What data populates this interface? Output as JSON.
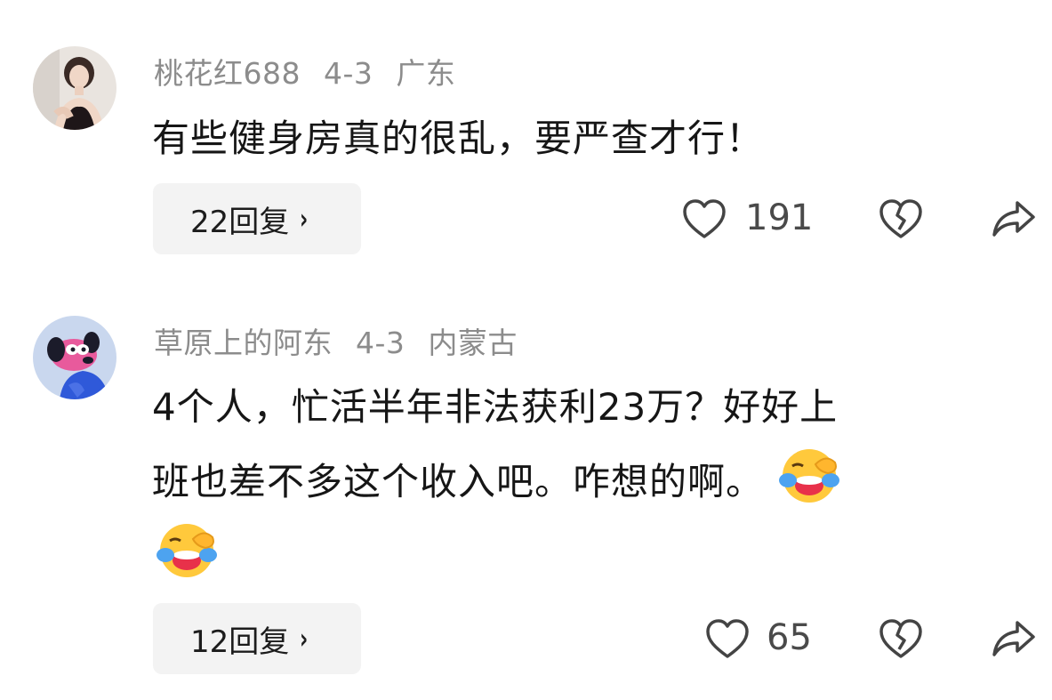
{
  "comments": [
    {
      "username": "桃花红688",
      "date": "4-3",
      "location": "广东",
      "text": "有些健身房真的很乱，要严查才行！",
      "reply_label": "22回复",
      "likes": "191"
    },
    {
      "username": "草原上的阿东",
      "date": "4-3",
      "location": "内蒙古",
      "text_line1": "4个人，忙活半年非法获利23万？好好上",
      "text_line2": "班也差不多这个收入吧。咋想的啊。",
      "emoji_name": "laughing-tears-emoji",
      "reply_label": "12回复",
      "likes": "65"
    }
  ],
  "icons": {
    "reply_chevron": "›",
    "like": "heart-outline-icon",
    "dislike": "broken-heart-icon",
    "share": "share-arrow-icon"
  },
  "colors": {
    "meta_text": "#8c8c8c",
    "body_text": "#161616",
    "reply_bg": "#f3f3f3"
  }
}
